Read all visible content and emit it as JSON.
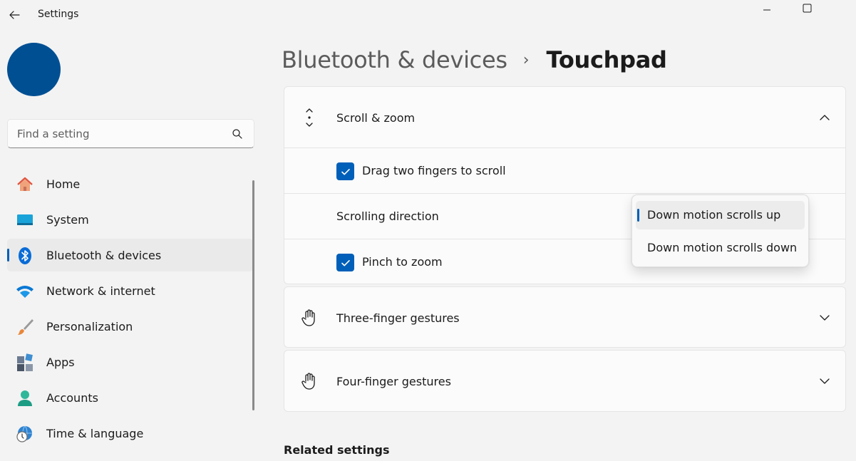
{
  "window": {
    "title": "Settings"
  },
  "search": {
    "placeholder": "Find a setting"
  },
  "sidebar": {
    "items": [
      {
        "label": "Home",
        "icon": "home-icon"
      },
      {
        "label": "System",
        "icon": "system-icon"
      },
      {
        "label": "Bluetooth & devices",
        "icon": "bluetooth-icon",
        "active": true
      },
      {
        "label": "Network & internet",
        "icon": "wifi-icon"
      },
      {
        "label": "Personalization",
        "icon": "brush-icon"
      },
      {
        "label": "Apps",
        "icon": "apps-icon"
      },
      {
        "label": "Accounts",
        "icon": "person-icon"
      },
      {
        "label": "Time & language",
        "icon": "clock-globe-icon"
      }
    ]
  },
  "breadcrumb": {
    "parent": "Bluetooth & devices",
    "separator": "›",
    "current": "Touchpad"
  },
  "sections": {
    "scroll_zoom": {
      "title": "Scroll & zoom",
      "expanded": true,
      "drag_scroll": {
        "label": "Drag two fingers to scroll",
        "checked": true
      },
      "scroll_direction": {
        "label": "Scrolling direction"
      },
      "pinch_zoom": {
        "label": "Pinch to zoom",
        "checked": true
      }
    },
    "three_finger": {
      "title": "Three-finger gestures",
      "expanded": false
    },
    "four_finger": {
      "title": "Four-finger gestures",
      "expanded": false
    }
  },
  "dropdown": {
    "options": [
      {
        "label": "Down motion scrolls up",
        "selected": true
      },
      {
        "label": "Down motion scrolls down",
        "selected": false
      }
    ]
  },
  "related": {
    "heading": "Related settings"
  },
  "colors": {
    "accent": "#005fb8",
    "avatar": "#004f93",
    "background": "#f3f3f3",
    "card": "#fbfbfb"
  }
}
